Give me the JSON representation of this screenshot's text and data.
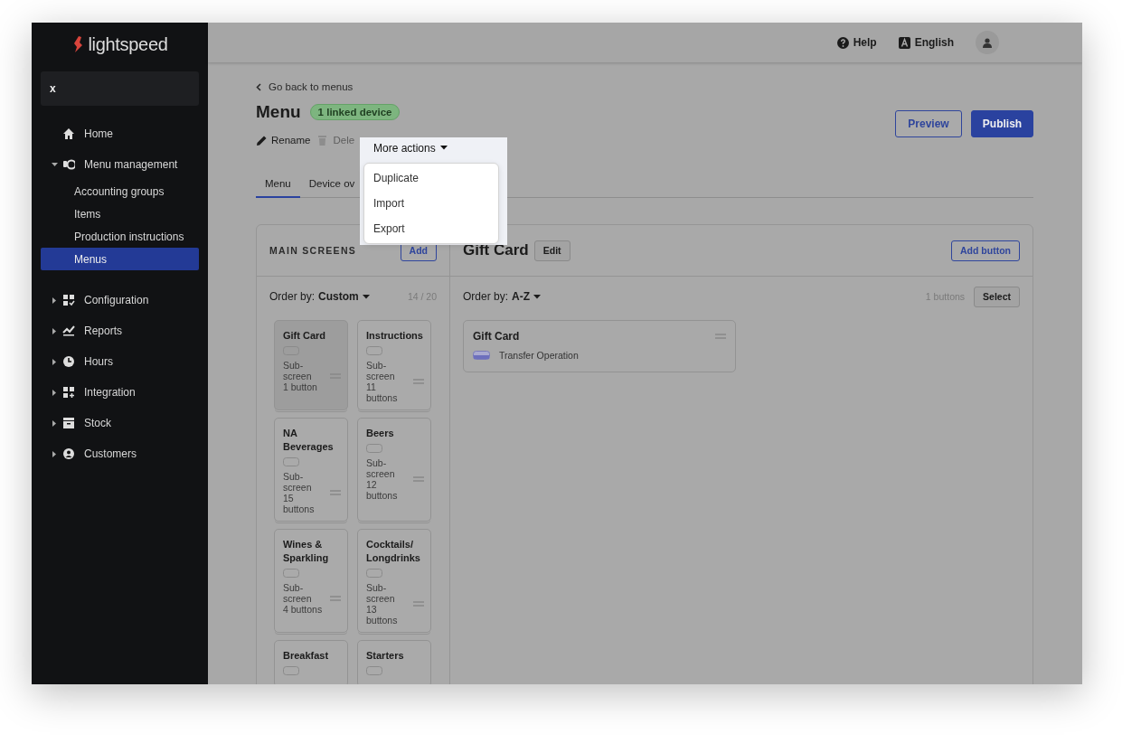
{
  "sidebar": {
    "logo": "lightspeed",
    "search": {
      "value": "x"
    },
    "items": [
      {
        "label": "Home"
      },
      {
        "label": "Menu management",
        "expanded": true,
        "children": [
          {
            "label": "Accounting groups",
            "selected": false
          },
          {
            "label": "Items",
            "selected": false
          },
          {
            "label": "Production instructions",
            "selected": false
          },
          {
            "label": "Menus",
            "selected": true
          }
        ]
      },
      {
        "label": "Configuration",
        "expanded": false
      },
      {
        "label": "Reports",
        "expanded": false
      },
      {
        "label": "Hours",
        "expanded": false
      },
      {
        "label": "Integration",
        "expanded": false
      },
      {
        "label": "Stock",
        "expanded": false
      },
      {
        "label": "Customers",
        "expanded": false
      }
    ]
  },
  "header": {
    "help": "Help",
    "language": "English"
  },
  "page": {
    "back_link": "Go back to menus",
    "title": "Menu",
    "badge": "1 linked device",
    "actions": [
      {
        "label": "Rename",
        "disabled": false
      },
      {
        "label": "Dele",
        "disabled": true
      }
    ],
    "more_actions": {
      "label": "More actions",
      "items": [
        "Duplicate",
        "Import",
        "Export"
      ]
    },
    "buttons": [
      {
        "label": "Preview",
        "kind": "secondary"
      },
      {
        "label": "Publish",
        "kind": "primary"
      }
    ],
    "tabs": [
      {
        "label": "Menu",
        "selected": true
      },
      {
        "label": "Device ov",
        "selected": false
      }
    ]
  },
  "main_screens": {
    "heading": "MAIN SCREENS",
    "add": "Add",
    "order_label": "Order by:",
    "order_value": "Custom",
    "count": "14 / 20",
    "screens": [
      {
        "name": "Gift Card",
        "type": "Sub-screen",
        "buttons": "1 button",
        "selected": true
      },
      {
        "name": "Instructions",
        "type": "Sub-screen",
        "buttons": "11 buttons",
        "selected": false
      },
      {
        "name": "NA Beverages",
        "type": "Sub-screen",
        "buttons": "15 buttons",
        "selected": false
      },
      {
        "name": "Beers",
        "type": "Sub-screen",
        "buttons": "12 buttons",
        "selected": false
      },
      {
        "name": "Wines & Sparkling",
        "type": "Sub-screen",
        "buttons": "4 buttons",
        "selected": false
      },
      {
        "name": "Cocktails/ Longdrinks",
        "type": "Sub-screen",
        "buttons": "13 buttons",
        "selected": false
      },
      {
        "name": "Breakfast",
        "selected": false
      },
      {
        "name": "Starters",
        "selected": false
      }
    ]
  },
  "screen_detail": {
    "title": "Gift Card",
    "edit": "Edit",
    "add_button": "Add button",
    "order_label": "Order by:",
    "order_value": "A-Z",
    "count": "1 buttons",
    "select": "Select",
    "buttons": [
      {
        "name": "Gift Card",
        "action": "Transfer Operation"
      }
    ]
  }
}
